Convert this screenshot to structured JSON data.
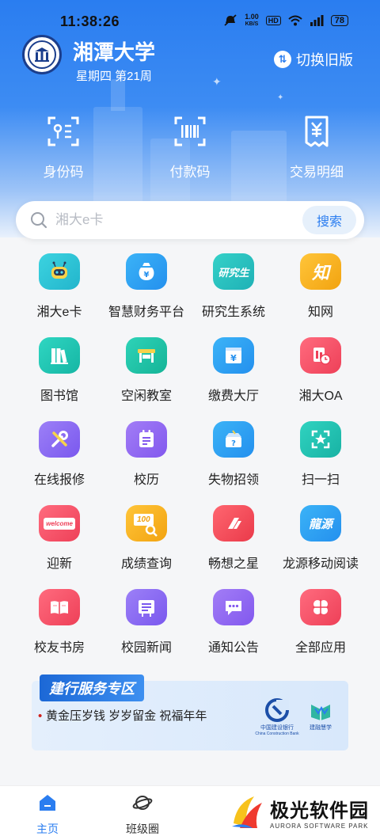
{
  "status_bar": {
    "time": "11:38:26",
    "net_speed_value": "1.00",
    "net_speed_unit": "KB/S",
    "hd": "HD",
    "battery": "78",
    "icons": [
      "mute-icon",
      "wifi-icon",
      "signal-icon"
    ]
  },
  "header": {
    "university_name": "湘潭大学",
    "week_info": "星期四 第21周",
    "switch_label": "切换旧版"
  },
  "quick_actions": [
    {
      "label": "身份码",
      "icon": "qr-id-icon"
    },
    {
      "label": "付款码",
      "icon": "barcode-icon"
    },
    {
      "label": "交易明细",
      "icon": "receipt-icon"
    }
  ],
  "search": {
    "placeholder": "湘大e卡",
    "button_label": "搜索"
  },
  "apps": [
    {
      "label": "湘大e卡",
      "icon": "robot-icon",
      "color": "#2ec4d6"
    },
    {
      "label": "智慧财务平台",
      "icon": "money-bag-icon",
      "color": "#2a9df4"
    },
    {
      "label": "研究生系统",
      "icon": "graduate-text-icon",
      "color": "#27c2c0",
      "text": "研究生"
    },
    {
      "label": "知网",
      "icon": "zhiwang-icon",
      "color": "#f5b120",
      "text": "知"
    },
    {
      "label": "图书馆",
      "icon": "books-icon",
      "color": "#1fc8b5"
    },
    {
      "label": "空闲教室",
      "icon": "desk-icon",
      "color": "#21c6a8"
    },
    {
      "label": "缴费大厅",
      "icon": "yuan-screen-icon",
      "color": "#2aa3f5"
    },
    {
      "label": "湘大OA",
      "icon": "oa-clock-icon",
      "color": "#f5566a"
    },
    {
      "label": "在线报修",
      "icon": "tools-icon",
      "color": "#8c6cf2"
    },
    {
      "label": "校历",
      "icon": "calendar-icon",
      "color": "#9a6bf0"
    },
    {
      "label": "失物招领",
      "icon": "lost-found-icon",
      "color": "#2aa3f5"
    },
    {
      "label": "扫一扫",
      "icon": "scan-star-icon",
      "color": "#22c5b3"
    },
    {
      "label": "迎新",
      "icon": "welcome-icon",
      "color": "#f5566a",
      "text": "welcome"
    },
    {
      "label": "成绩查询",
      "icon": "grade-search-icon",
      "color": "#f7b227",
      "text": "100"
    },
    {
      "label": "畅想之星",
      "icon": "star-logo-icon",
      "color": "#f2525e"
    },
    {
      "label": "龙源移动阅读",
      "icon": "longyuan-icon",
      "color": "#2aa3f5",
      "text": "龍源"
    },
    {
      "label": "校友书房",
      "icon": "open-book-icon",
      "color": "#f5566a"
    },
    {
      "label": "校园新闻",
      "icon": "news-icon",
      "color": "#8c6cf2"
    },
    {
      "label": "通知公告",
      "icon": "chat-bubble-icon",
      "color": "#8c6cf2"
    },
    {
      "label": "全部应用",
      "icon": "all-apps-icon",
      "color": "#f5566a"
    }
  ],
  "banner": {
    "title": "建行服务专区",
    "text": "黄金压岁钱 岁岁留金 祝福年年",
    "bank_name_cn": "中国建设银行",
    "bank_name_en": "China Construction Bank",
    "partner_label": "建融慧学"
  },
  "tabbar": {
    "items": [
      {
        "label": "主页",
        "icon": "home-icon",
        "active": true
      },
      {
        "label": "班级圈",
        "icon": "planet-icon",
        "active": false
      }
    ]
  },
  "watermark": {
    "name_cn": "极光软件园",
    "name_en": "AURORA SOFTWARE PARK"
  }
}
